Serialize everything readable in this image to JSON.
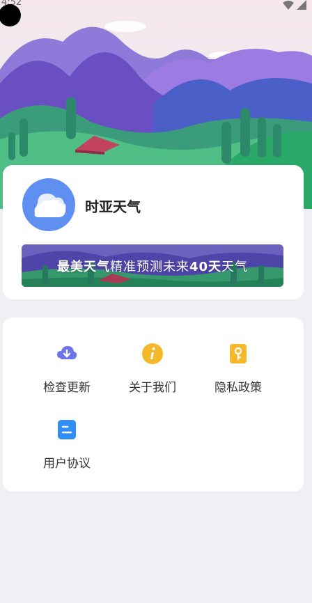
{
  "status": {
    "time": "4:52"
  },
  "app": {
    "name": "时亚天气",
    "icon": "cloud-icon"
  },
  "banner": {
    "part1": "最美天气",
    "part2": "精准预测未来",
    "part3": "40天",
    "part4": "天气"
  },
  "menu": {
    "items": [
      {
        "label": "检查更新",
        "icon": "cloud-download-icon",
        "color": "#6b74e8"
      },
      {
        "label": "关于我们",
        "icon": "info-icon",
        "color": "#f5b82a"
      },
      {
        "label": "隐私政策",
        "icon": "lock-document-icon",
        "color": "#f5b82a"
      },
      {
        "label": "用户协议",
        "icon": "agreement-document-icon",
        "color": "#2f8ef5"
      }
    ]
  },
  "colors": {
    "background": "#efeff4",
    "app_icon": "#5f8ff0"
  }
}
